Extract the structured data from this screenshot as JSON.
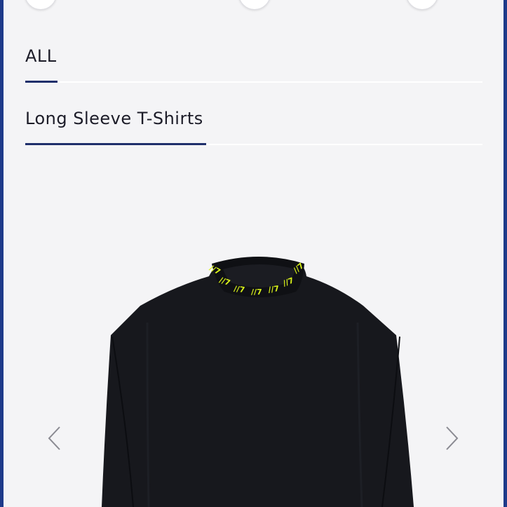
{
  "breadcrumb": {
    "level1": {
      "label": "ALL"
    },
    "level2": {
      "label": "Long Sleeve T-Shirts"
    }
  },
  "product": {
    "image_icon": "black-long-sleeve-tshirt",
    "collar_color": "#d9f21a",
    "body_color": "#17181d"
  },
  "carousel": {
    "prev_icon": "chevron-left-icon",
    "next_icon": "chevron-right-icon"
  },
  "colors": {
    "accent": "#1f2f6b",
    "background": "#f4f4f6",
    "frame": "#1e3a8a"
  }
}
